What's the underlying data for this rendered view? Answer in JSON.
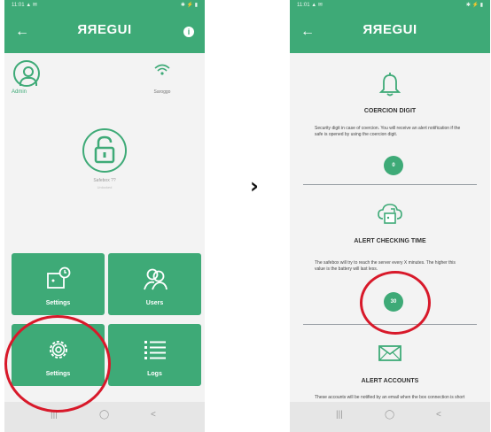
{
  "left_screen": {
    "status": {
      "time": "11:01 ▲ ✉",
      "icons": "✱ ⚡ ▮"
    },
    "brand": "ЯЯEGUI",
    "user": {
      "label": "Admin"
    },
    "network": {
      "label": "Saroggo"
    },
    "safebox": {
      "name": "Safebox ??",
      "sub": "Unlocked"
    },
    "tiles": [
      {
        "label": "Settings"
      },
      {
        "label": "Users"
      },
      {
        "label": "Settings"
      },
      {
        "label": "Logs"
      }
    ]
  },
  "right_screen": {
    "status": {
      "time": "11:01 ▲ ✉",
      "icons": "✱ ⚡ ▮"
    },
    "brand": "ЯЯEGUI",
    "coercion": {
      "title": "COERCION DIGIT",
      "description": "Security digit in case of coercion. You will receive an alert notification if the safe is opened by using the coercion digit.",
      "value": "0"
    },
    "alert_checking": {
      "title": "ALERT CHECKING TIME",
      "description": "The safebox will try to reach the server every X minutes. The higher this value is the battery will last less.",
      "value": "30"
    },
    "alert_accounts": {
      "title": "ALERT ACCOUNTS",
      "description": "These accounts will be notified by an email when the box connection is short"
    }
  },
  "navbar": {
    "recent": "|||",
    "home": "◯",
    "back": "<"
  },
  "chevron": "›",
  "colors": {
    "accent": "#3eaa77",
    "highlight": "#d8192a"
  }
}
